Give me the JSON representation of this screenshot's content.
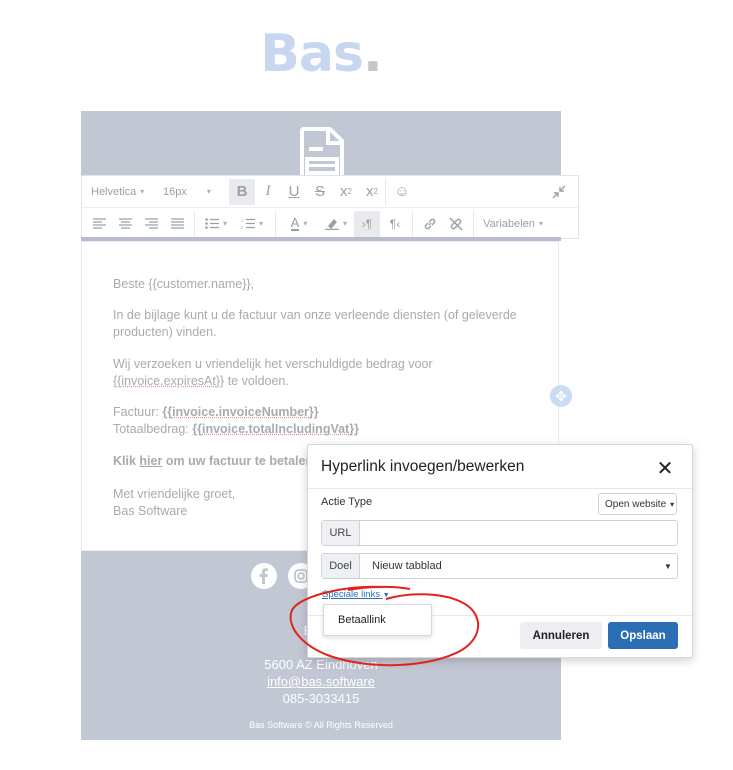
{
  "logo": {
    "text": "Bas",
    "dot": "."
  },
  "toolbar": {
    "font_family": "Helvetica",
    "font_size": "16px",
    "variables_label": "Variabelen"
  },
  "content": {
    "greeting": "Beste {{customer.name}},",
    "para1": "In de bijlage kunt u de factuur van onze verleende diensten (of geleverde producten) vinden.",
    "para2_text": "Wij verzoeken u vriendelijk het verschuldigde bedrag voor",
    "para2_var": "{{invoice.expiresAt}}",
    "para2_end": "te voldoen.",
    "invoice_label": "Factuur:",
    "invoice_var": "{{invoice.invoiceNumber}}",
    "total_label": "Totaalbedrag:",
    "total_var": "{{invoice.totalIncludingVat}}",
    "click_prefix": "Klik",
    "click_link": "hier",
    "click_suffix": "om uw factuur te betalen",
    "regards": "Met vriendelijke groet,",
    "signature": "Bas Software"
  },
  "footer": {
    "line1": "C",
    "line2": "Bas S",
    "line3": "Pos",
    "city": "5600 AZ Eindhoven",
    "email": "info@bas.software",
    "phone": "085-3033415",
    "copyright": "Bas Software ©  All Rights Reserved"
  },
  "modal": {
    "title": "Hyperlink invoegen/bewerken",
    "close": "✕",
    "action_type_label": "Actie Type",
    "action_type_value": "Open website",
    "url_label": "URL",
    "url_value": "",
    "target_label": "Doel",
    "target_value": "Nieuw tabblad",
    "special_links": "Speciale links",
    "dropdown_item": "Betaallink",
    "cancel": "Annuleren",
    "save": "Opslaan"
  },
  "colors": {
    "accent_blue": "#2a6fb3",
    "band_gray": "#c2c7d4",
    "annotation_red": "#e0241b"
  },
  "icons": [
    "invoice-document-icon",
    "facebook-icon",
    "instagram-icon",
    "move-icon",
    "close-icon",
    "bold-icon",
    "italic-icon",
    "underline-icon",
    "strikethrough-icon",
    "superscript-icon",
    "subscript-icon",
    "emoji-icon",
    "collapse-icon",
    "align-left-icon",
    "align-center-icon",
    "align-right-icon",
    "justify-icon",
    "bullet-list-icon",
    "numbered-list-icon",
    "font-color-icon",
    "highlight-icon",
    "ltr-icon",
    "rtl-icon",
    "link-icon",
    "unlink-icon"
  ]
}
